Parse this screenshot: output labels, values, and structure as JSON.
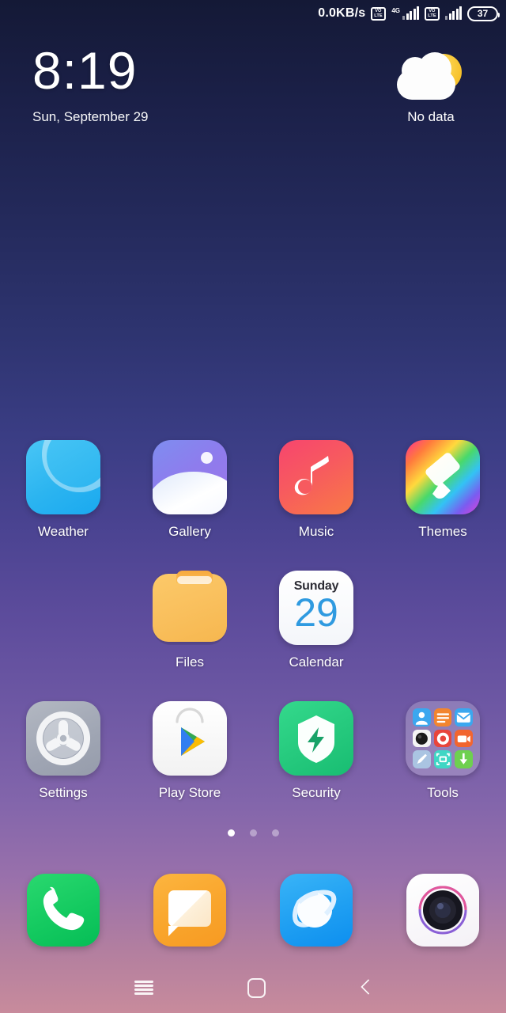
{
  "status_bar": {
    "network_speed": "0.0KB/s",
    "sim1_volte": "VoLTE",
    "sim1_network": "4G",
    "sim2_volte": "VoLTE",
    "battery_level": "37"
  },
  "widget": {
    "time": "8:19",
    "date": "Sun, September 29",
    "weather_text": "No data",
    "weather_icon": "sun-behind-cloud-icon"
  },
  "home_screen": {
    "rows": [
      [
        {
          "label": "Weather",
          "icon": "weather-app-icon",
          "art": "ic-weather"
        },
        {
          "label": "Gallery",
          "icon": "gallery-app-icon",
          "art": "ic-gallery"
        },
        {
          "label": "Music",
          "icon": "music-app-icon",
          "art": "ic-music"
        },
        {
          "label": "Themes",
          "icon": "themes-app-icon",
          "art": "ic-themes"
        }
      ],
      [
        {
          "label": "",
          "icon": "empty-slot",
          "art": "empty"
        },
        {
          "label": "Files",
          "icon": "files-app-icon",
          "art": "ic-files"
        },
        {
          "label": "Calendar",
          "icon": "calendar-app-icon",
          "art": "ic-calendar"
        },
        {
          "label": "",
          "icon": "empty-slot",
          "art": "empty"
        }
      ],
      [
        {
          "label": "Settings",
          "icon": "settings-app-icon",
          "art": "ic-settings"
        },
        {
          "label": "Play Store",
          "icon": "play-store-app-icon",
          "art": "ic-play"
        },
        {
          "label": "Security",
          "icon": "security-app-icon",
          "art": "ic-security"
        },
        {
          "label": "Tools",
          "icon": "tools-folder-icon",
          "art": "ic-folder"
        }
      ]
    ],
    "calendar_icon": {
      "weekday": "Sunday",
      "day": "29"
    },
    "tools_folder_apps": [
      {
        "name": "contacts",
        "color": "#3ba7ef"
      },
      {
        "name": "notes",
        "color": "#f2852f"
      },
      {
        "name": "mail",
        "color": "#3ba7ef"
      },
      {
        "name": "camera",
        "color": "#f2f2f2"
      },
      {
        "name": "recorder",
        "color": "#e8453c"
      },
      {
        "name": "video",
        "color": "#f2652f"
      },
      {
        "name": "editor",
        "color": "#aac4e2"
      },
      {
        "name": "scanner",
        "color": "#3fd6c4"
      },
      {
        "name": "downloads",
        "color": "#6ed04f"
      }
    ],
    "page_indicator": {
      "total": 3,
      "active": 1
    }
  },
  "dock": [
    {
      "label": "Phone",
      "icon": "phone-app-icon",
      "art": "ic-phone"
    },
    {
      "label": "Messages",
      "icon": "messages-app-icon",
      "art": "ic-msg"
    },
    {
      "label": "Browser",
      "icon": "browser-app-icon",
      "art": "ic-browser"
    },
    {
      "label": "Camera",
      "icon": "camera-app-icon",
      "art": "ic-camera"
    }
  ],
  "nav_bar": {
    "recents": "recents-icon",
    "home": "home-icon",
    "back": "back-icon"
  },
  "colors": {
    "bg_top": "#141936",
    "bg_mid": "#4a4391",
    "bg_bottom": "#c88b9c",
    "accent_blue": "#2f9ae0"
  }
}
